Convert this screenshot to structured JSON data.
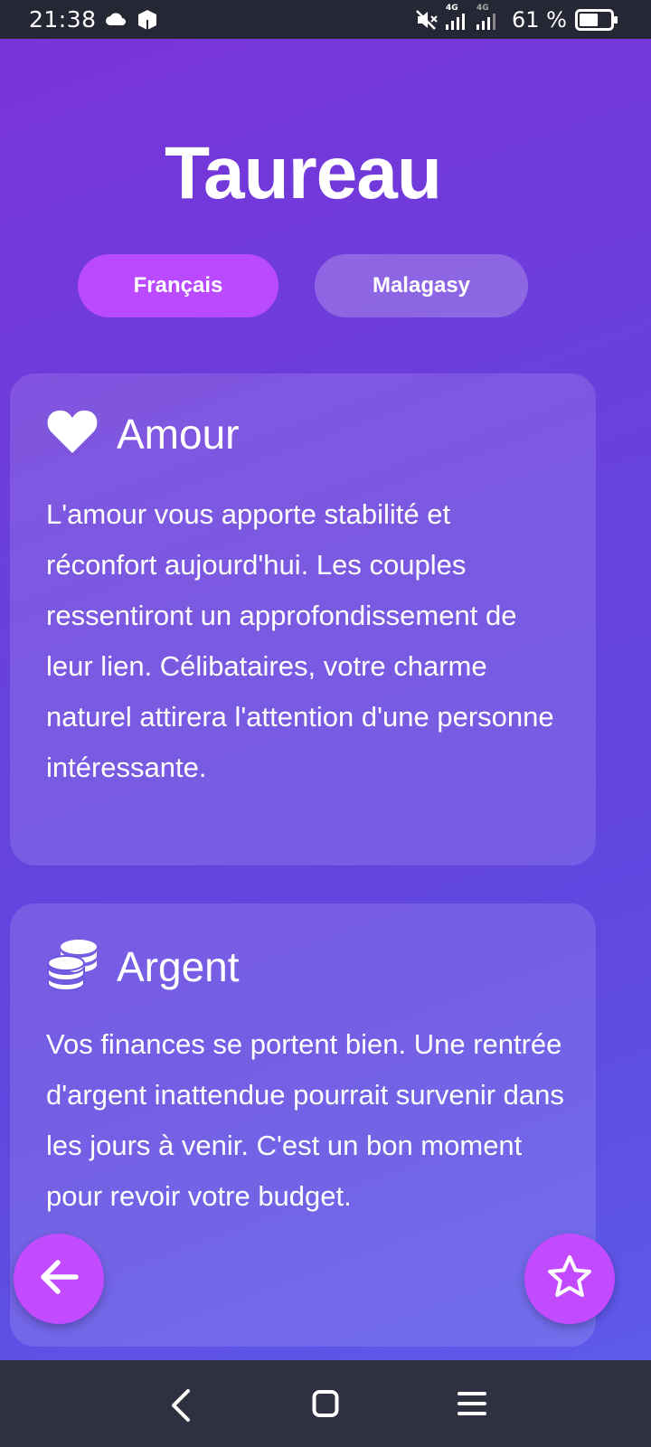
{
  "status_bar": {
    "time": "21:38",
    "network_label_1": "4G",
    "network_label_2": "4G",
    "battery_text": "61 %",
    "battery_level": 0.61
  },
  "page": {
    "title": "Taureau"
  },
  "languages": {
    "french_label": "Français",
    "malagasy_label": "Malagasy",
    "selected": "Français"
  },
  "sections": [
    {
      "icon": "heart-icon",
      "title": "Amour",
      "text": "L'amour vous apporte stabilité et réconfort aujourd'hui. Les couples ressentiront un approfondissement de leur lien. Célibataires, votre charme naturel attirera l'attention d'une personne intéressante."
    },
    {
      "icon": "coins-icon",
      "title": "Argent",
      "text": "Vos finances se portent bien. Une rentrée d'argent inattendue pourrait survenir dans les jours à venir. C'est un bon moment pour revoir votre budget."
    }
  ],
  "colors": {
    "accent": "#b94aff",
    "background_start": "#7a33d9",
    "background_end": "#5d5aea",
    "status_bar": "#262735",
    "nav_bar": "#2f3040"
  }
}
